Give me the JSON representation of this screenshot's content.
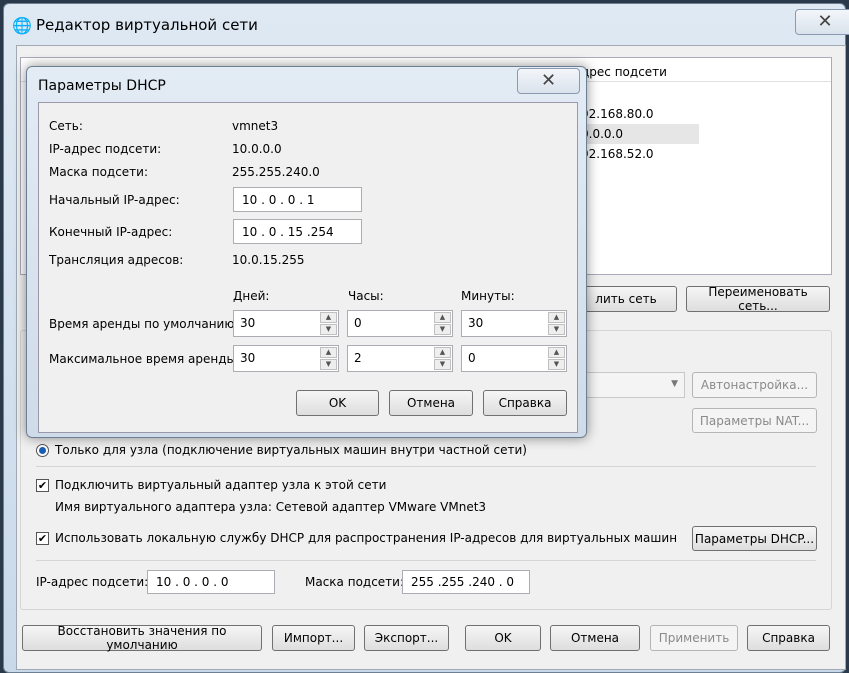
{
  "main": {
    "title": "Редактор виртуальной сети",
    "close_icon": "close-icon",
    "list": {
      "header": "дрес подсети",
      "rows": [
        "92.168.80.0",
        "0.0.0.0",
        "92.168.52.0"
      ]
    },
    "remove_network_partial": "лить сеть",
    "rename_network": "Переименовать сеть...",
    "auto_setup": "Автонастройка...",
    "nat_settings": "Параметры NAT...",
    "host_only_radio": "Только для узла (подключение виртуальных машин внутри частной сети)",
    "connect_adapter": "Подключить виртуальный адаптер узла к этой сети",
    "adapter_name": "Имя виртуального адаптера узла: Сетевой адаптер VMware VMnet3",
    "use_dhcp": "Использовать локальную службу DHCP для распространения IP-адресов для виртуальных машин",
    "dhcp_settings": "Параметры DHCP...",
    "subnet_ip_label": "IP-адрес подсети:",
    "subnet_ip": "10 . 0 . 0 . 0",
    "subnet_mask_label": "Маска подсети:",
    "subnet_mask": "255 .255 .240 . 0",
    "restore_defaults": "Восстановить значения по умолчанию",
    "import": "Импорт...",
    "export": "Экспорт...",
    "ok": "OK",
    "cancel": "Отмена",
    "apply": "Применить",
    "help": "Справка"
  },
  "dhcp": {
    "title": "Параметры DHCP",
    "network_label": "Сеть:",
    "network": "vmnet3",
    "subnet_ip_label": "IP-адрес подсети:",
    "subnet_ip": "10.0.0.0",
    "mask_label": "Маска подсети:",
    "mask": "255.255.240.0",
    "start_label": "Начальный IP-адрес:",
    "start": "10 . 0 . 0 . 1",
    "end_label": "Конечный IP-адрес:",
    "end": "10 . 0 . 15 .254",
    "broadcast_label": "Трансляция адресов:",
    "broadcast": "10.0.15.255",
    "days": "Дней:",
    "hours": "Часы:",
    "minutes": "Минуты:",
    "default_lease_label": "Время аренды по умолчанию:",
    "default_lease": [
      "30",
      "0",
      "30"
    ],
    "max_lease_label": "Максимальное время аренды:",
    "max_lease": [
      "30",
      "2",
      "0"
    ],
    "ok": "OK",
    "cancel": "Отмена",
    "help": "Справка"
  }
}
